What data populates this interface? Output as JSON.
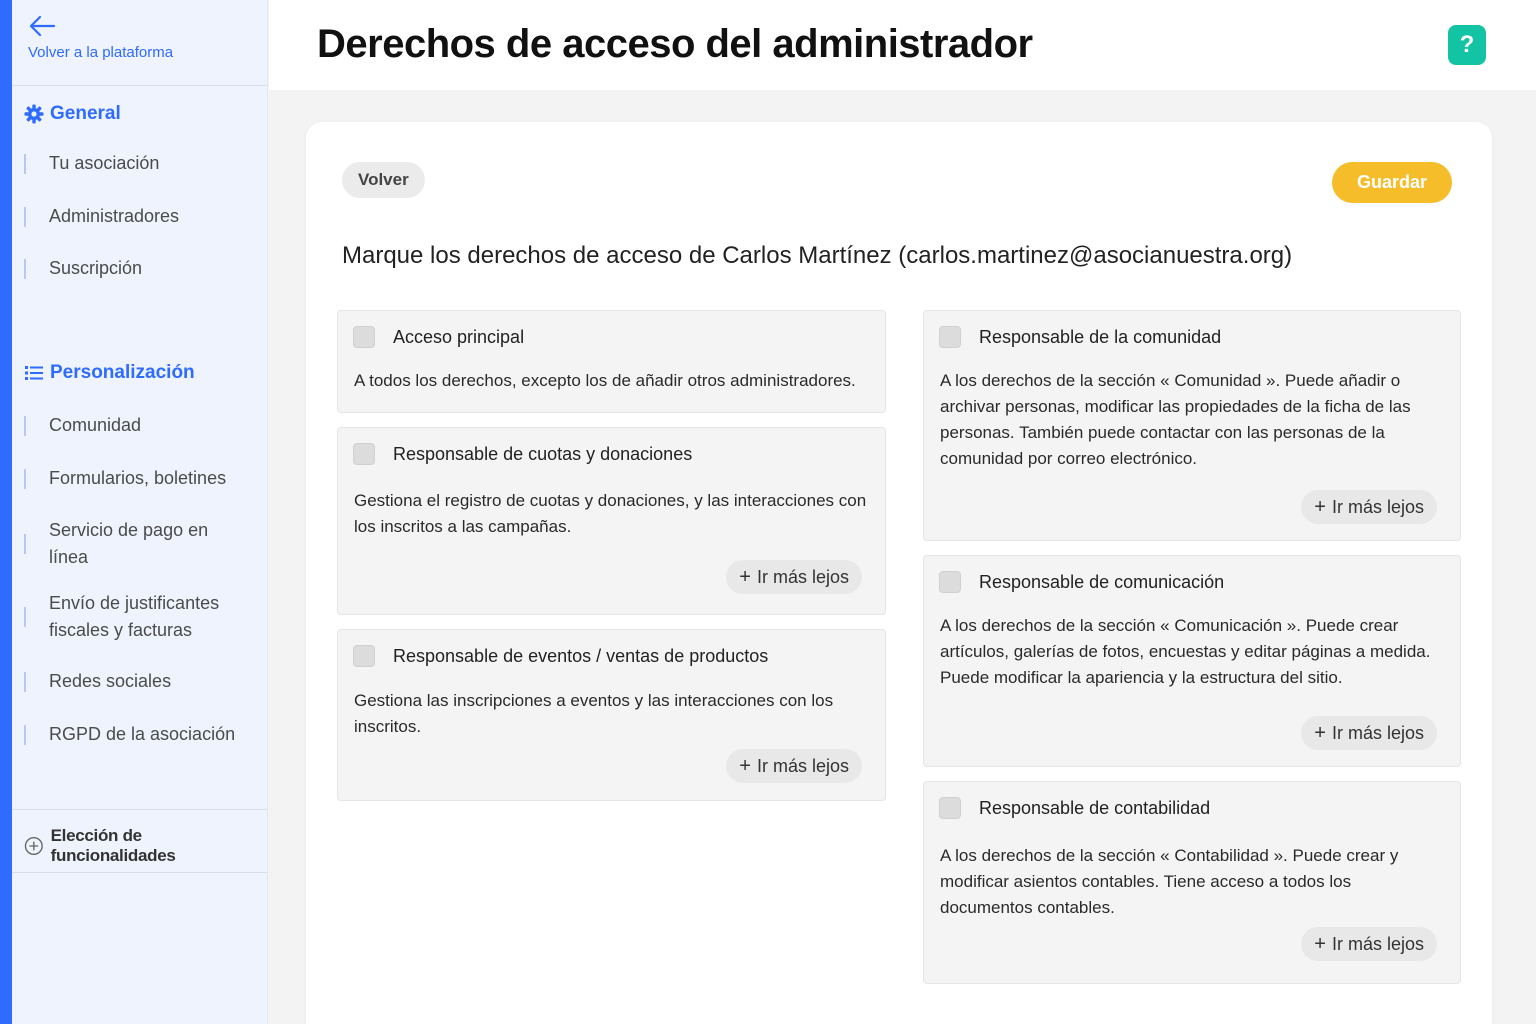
{
  "sidebar": {
    "back_label": "Volver a la plataforma",
    "general_title": "General",
    "general_items": [
      "Tu asociación",
      "Administradores",
      "Suscripción"
    ],
    "custom_title": "Personalización",
    "custom_items": [
      "Comunidad",
      "Formularios, boletines",
      "Servicio de pago en línea",
      "Envío de justificantes fiscales y facturas",
      "Redes sociales",
      "RGPD de la asociación"
    ],
    "features_label": "Elección de funcionalidades"
  },
  "header": {
    "title": "Derechos de acceso del administrador",
    "help_label": "?"
  },
  "card": {
    "back_label": "Volver",
    "save_label": "Guardar",
    "intro": "Marque los derechos de acceso de Carlos Martínez (carlos.martinez@asocianuestra.org)",
    "more_label": "Ir más lejos",
    "permissions": [
      {
        "title": "Acceso principal",
        "desc": "A todos los derechos, excepto los de añadir otros administradores.",
        "checked": false
      },
      {
        "title": "Responsable de cuotas y donaciones",
        "desc": "Gestiona el registro de cuotas y donaciones, y las interacciones con los inscritos a las campañas.",
        "checked": false
      },
      {
        "title": "Responsable de eventos / ventas de productos",
        "desc": "Gestiona las inscripciones a eventos y las interacciones con los inscritos.",
        "checked": false
      },
      {
        "title": "Responsable de la comunidad",
        "desc": "A los derechos de la sección « Comunidad ». Puede añadir o archivar personas, modificar las propiedades de la ficha de las personas. También puede contactar con las personas de la comunidad por correo electrónico.",
        "checked": false
      },
      {
        "title": "Responsable de comunicación",
        "desc": "A los derechos de la sección « Comunicación ». Puede crear artículos, galerías de fotos, encuestas y editar páginas a medida. Puede modificar la apariencia y la estructura del sitio.",
        "checked": false
      },
      {
        "title": "Responsable de contabilidad",
        "desc": "A los derechos de la sección « Contabilidad ». Puede crear y modificar asientos contables. Tiene acceso a todos los documentos contables.",
        "checked": false
      }
    ]
  },
  "colors": {
    "accent": "#2f6bff",
    "save": "#f6bd2a",
    "help": "#12c4a3"
  }
}
